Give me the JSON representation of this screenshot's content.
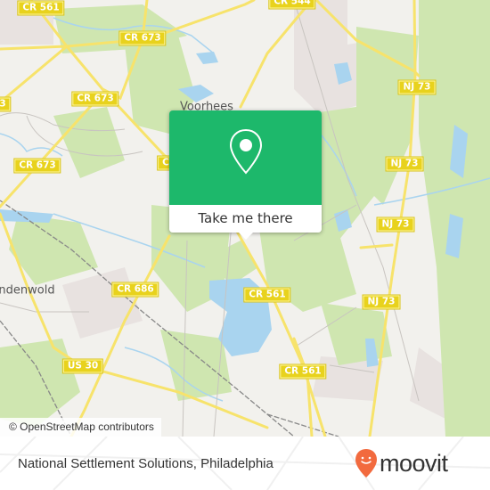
{
  "map": {
    "attribution": "© OpenStreetMap contributors",
    "colors": {
      "land": "#f2f1ed",
      "park": "#cfe6b0",
      "water": "#a9d4ef",
      "road": "#f7e36b",
      "shield": "#e8d21d",
      "rail": "#888888",
      "residential": "#e8e2e0"
    },
    "road_labels": [
      {
        "id": "cr561-top",
        "text": "CR 561"
      },
      {
        "id": "cr673-top",
        "text": "CR 673"
      },
      {
        "id": "cr544",
        "text": "CR 544"
      },
      {
        "id": "cr673-mid",
        "text": "CR 673"
      },
      {
        "id": "cr673-left",
        "text": "CR 673"
      },
      {
        "id": "cr-edge-left",
        "text": "3"
      },
      {
        "id": "cr-edge-mid",
        "text": "C"
      },
      {
        "id": "nj73-a",
        "text": "NJ 73"
      },
      {
        "id": "nj73-b",
        "text": "NJ 73"
      },
      {
        "id": "nj73-c",
        "text": "NJ 73"
      },
      {
        "id": "nj73-d",
        "text": "NJ 73"
      },
      {
        "id": "cr686",
        "text": "CR 686"
      },
      {
        "id": "cr561-mid",
        "text": "CR 561"
      },
      {
        "id": "cr561-low",
        "text": "CR 561"
      },
      {
        "id": "us30",
        "text": "US 30"
      }
    ],
    "places": [
      {
        "id": "voorhees",
        "text": "Voorhees"
      },
      {
        "id": "lindenwold",
        "text": "ndenwold"
      }
    ]
  },
  "popup": {
    "icon": "map-pin-icon",
    "accent_color": "#1db86b",
    "action_label": "Take me there"
  },
  "footer": {
    "title": "National Settlement Solutions, Philadelphia",
    "logo": {
      "text": "moovit",
      "icon": "moovit-pin-smile-icon",
      "color": "#f26a3e"
    }
  }
}
